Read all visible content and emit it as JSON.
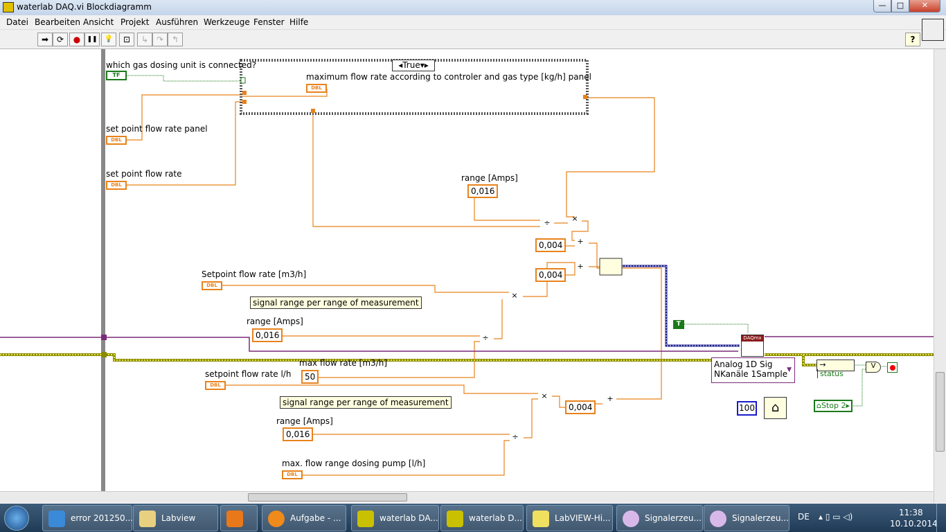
{
  "window": {
    "title": "waterlab DAQ.vi Blockdiagramm",
    "minimize": "—",
    "maximize": "□",
    "close": "✕"
  },
  "menu": [
    "Datei",
    "Bearbeiten",
    "Ansicht",
    "Projekt",
    "Ausführen",
    "Werkzeuge",
    "Fenster",
    "Hilfe"
  ],
  "toolbar": {
    "run": "➡",
    "run_continuous": "⟳",
    "abort": "●",
    "pause": "❚❚",
    "highlight": "💡",
    "retain": "⊡",
    "step_into": "↳",
    "step_over": "↷",
    "step_out": "↰",
    "help": "?"
  },
  "diagram": {
    "case_selector": "True",
    "labels": {
      "gas_unit": "which gas dosing unit is connected?",
      "max_flow": "maximum flow rate according to controler and gas type [kg/h] panel",
      "sp_panel": "set point flow rate panel",
      "sp": "set point flow rate",
      "range1": "range [Amps]",
      "sp_m3h": "Setpoint flow rate [m3/h]",
      "range2": "range [Amps]",
      "max_m3h": "max flow rate [m3/h]",
      "sp_lh": "setpoint flow rate l/h",
      "range3": "range [Amps]",
      "max_pump": "max. flow range dosing pump [l/h]"
    },
    "notes": [
      "signal range per range of measurement",
      "signal range per range of measurement"
    ],
    "constants": {
      "range1": "0,016",
      "off1": "0,004",
      "off2": "0,004",
      "range2": "0,016",
      "max_m3h": "50",
      "off3": "0,004",
      "range3": "0,016",
      "wait": "100",
      "true_const": "T",
      "tf": "TF"
    },
    "dbl": "DBL",
    "daqmx": {
      "badge": "DAQmx",
      "selector_line1": "Analog 1D Sig",
      "selector_line2": "NKanäle 1Sample"
    },
    "status": "status",
    "stop": "Stop 2",
    "or": "V"
  },
  "taskbar": {
    "items": [
      "error 201250...",
      "Labview",
      "",
      "Aufgabe - ...",
      "waterlab DA...",
      "waterlab D...",
      "LabVIEW-Hi...",
      "Signalerzeu...",
      "Signalerzeu..."
    ],
    "lang": "DE",
    "time": "11:38",
    "date": "10.10.2014"
  },
  "colors": {
    "wire_orange": "#e8821b",
    "wire_blue": "#1a1a8c",
    "wire_purple": "#7a2a7a",
    "wire_error": "#c8c000",
    "bool_green": "#1a7a1a"
  }
}
